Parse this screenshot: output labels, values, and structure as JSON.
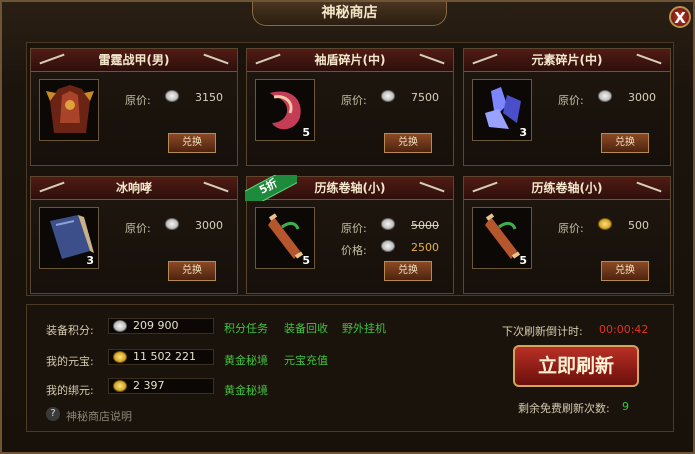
{
  "window": {
    "title": "神秘商店",
    "close_label": "X"
  },
  "labels": {
    "original_price": "原价:",
    "price": "价格:",
    "buy": "兑换"
  },
  "items": [
    {
      "name": "雷霆战甲(男)",
      "price": "3150",
      "qty": "",
      "currency": "silver",
      "icon": "armor-icon"
    },
    {
      "name": "袖盾碎片(中)",
      "price": "7500",
      "qty": "5",
      "currency": "silver",
      "icon": "shield-shard-icon"
    },
    {
      "name": "元素碎片(中)",
      "price": "3000",
      "qty": "3",
      "currency": "silver",
      "icon": "crystal-icon"
    },
    {
      "name": "冰响哮",
      "price": "3000",
      "qty": "3",
      "currency": "silver",
      "icon": "book-icon"
    },
    {
      "name": "历练卷轴(小)",
      "price": "5000",
      "discount_price": "2500",
      "discount_tag": "5折",
      "qty": "5",
      "currency": "silver",
      "icon": "scroll-icon"
    },
    {
      "name": "历练卷轴(小)",
      "price": "500",
      "qty": "5",
      "currency": "gold",
      "icon": "scroll-icon"
    }
  ],
  "footer": {
    "points_label": "装备积分:",
    "points_value": "209 900",
    "yuanbao_label": "我的元宝:",
    "yuanbao_value": "11 502 221",
    "bound_label": "我的绑元:",
    "bound_value": "2 397",
    "links_points": [
      "积分任务",
      "装备回收",
      "野外挂机"
    ],
    "links_yuanbao": [
      "黄金秘境",
      "元宝充值"
    ],
    "links_bound": [
      "黄金秘境"
    ],
    "help_text": "神秘商店说明",
    "timer_label": "下次刷新倒计时:",
    "timer_value": "00:00:42",
    "refresh_button": "立即刷新",
    "free_label": "剩余免费刷新次数:",
    "free_value": "9"
  },
  "colors": {
    "accent_red": "#b93026",
    "link_green": "#3ec43e",
    "timer_red": "#e0322a",
    "discount_gold": "#e5b13a"
  }
}
